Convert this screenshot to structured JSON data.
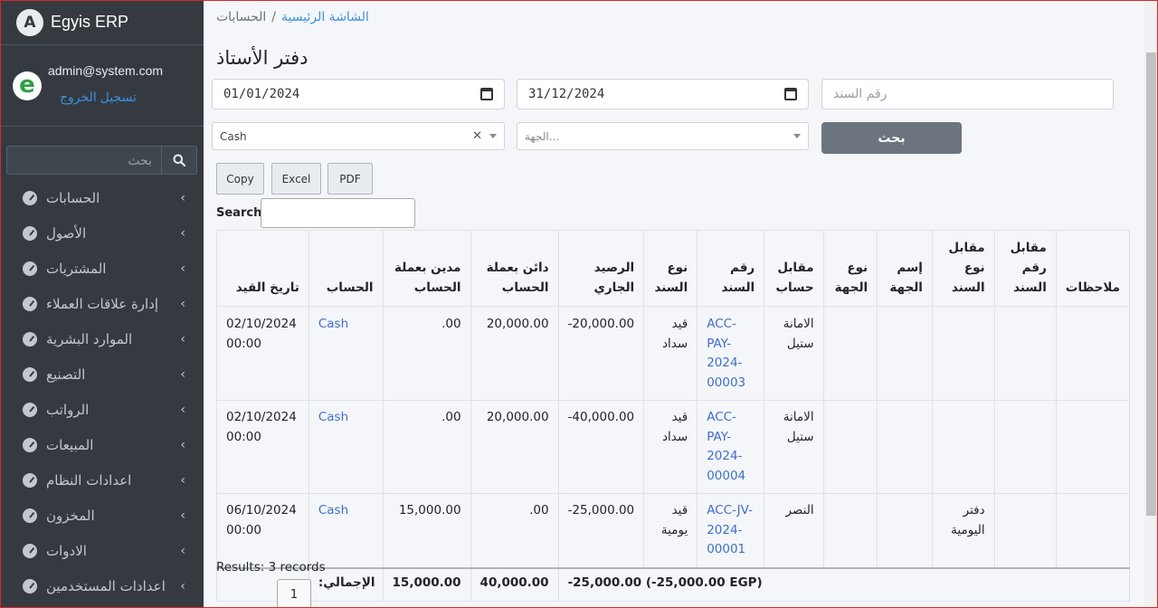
{
  "brand": {
    "logo_letter": "A",
    "name": "Egyis ERP"
  },
  "user": {
    "avatar_letter": "e",
    "email": "admin@system.com",
    "logout": "تسجيل الخروج"
  },
  "sidebar": {
    "search_placeholder": "بحث",
    "items": [
      {
        "label": "الحسابات",
        "icon": "gauge-icon"
      },
      {
        "label": "الأصول",
        "icon": "gauge-icon"
      },
      {
        "label": "المشتريات",
        "icon": "gauge-icon"
      },
      {
        "label": "إدارة علاقات العملاء",
        "icon": "gauge-icon"
      },
      {
        "label": "الموارد البشرية",
        "icon": "gauge-icon"
      },
      {
        "label": "التصنيع",
        "icon": "gauge-icon"
      },
      {
        "label": "الرواتب",
        "icon": "gauge-icon"
      },
      {
        "label": "المبيعات",
        "icon": "gauge-icon"
      },
      {
        "label": "اعدادات النظام",
        "icon": "gauge-icon"
      },
      {
        "label": "المخزون",
        "icon": "gauge-icon"
      },
      {
        "label": "الادوات",
        "icon": "gauge-icon"
      },
      {
        "label": "اعدادات المستخدمين",
        "icon": "gauge-icon"
      }
    ]
  },
  "breadcrumb": {
    "home": "الشاشة الرئيسية",
    "separator": "/",
    "current": "الحسابات"
  },
  "page_title": "دفتر الأستاذ",
  "filters": {
    "date_from": "01/01/2024",
    "date_to": "31/12/2024",
    "voucher_placeholder": "رقم السند",
    "account_value": "Cash",
    "entity_placeholder": "الجهة...",
    "search_button": "بحث"
  },
  "export_buttons": {
    "copy": "Copy",
    "excel": "Excel",
    "pdf": "PDF"
  },
  "table_search_label": "Search:",
  "table": {
    "headers": {
      "date": "تاريخ القيد",
      "account": "الحساب",
      "debit": "مدين بعملة الحساب",
      "credit": "دائن بعملة الحساب",
      "balance": "الرصيد الجاري",
      "voucher_type": "نوع السند",
      "voucher_no": "رقم السند",
      "counter_account": "مقابل حساب",
      "entity_type": "نوع الجهة",
      "entity_name": "إسم الجهة",
      "counter_voucher_type": "مقابل نوع السند",
      "counter_voucher_no": "مقابل رقم السند",
      "notes": "ملاحظات"
    },
    "rows": [
      {
        "date": "02/10/2024",
        "time": "00:00",
        "account": "Cash",
        "debit": ".00",
        "credit": "20,000.00",
        "balance": "-20,000.00",
        "voucher_type_1": "قيد",
        "voucher_type_2": "سداد",
        "voucher_no_1": "ACC-PAY-",
        "voucher_no_2": "2024-",
        "voucher_no_3": "00003",
        "counter_1": "الامانة",
        "counter_2": "ستيل",
        "counter_voucher_type_1": "",
        "counter_voucher_type_2": ""
      },
      {
        "date": "02/10/2024",
        "time": "00:00",
        "account": "Cash",
        "debit": ".00",
        "credit": "20,000.00",
        "balance": "-40,000.00",
        "voucher_type_1": "قيد",
        "voucher_type_2": "سداد",
        "voucher_no_1": "ACC-PAY-",
        "voucher_no_2": "2024-",
        "voucher_no_3": "00004",
        "counter_1": "الامانة",
        "counter_2": "ستيل",
        "counter_voucher_type_1": "",
        "counter_voucher_type_2": ""
      },
      {
        "date": "06/10/2024",
        "time": "00:00",
        "account": "Cash",
        "debit": "15,000.00",
        "credit": ".00",
        "balance": "-25,000.00",
        "voucher_type_1": "قيد",
        "voucher_type_2": "يومية",
        "voucher_no_1": "ACC-JV-",
        "voucher_no_2": "2024-",
        "voucher_no_3": "00001",
        "counter_1": "النصر",
        "counter_2": "",
        "counter_voucher_type_1": "دفتر",
        "counter_voucher_type_2": "اليومية"
      }
    ],
    "footer": {
      "label": ":الإجمالي",
      "debit": "15,000.00",
      "credit": "40,000.00",
      "balance": "-25,000.00 (-25,000.00 EGP)"
    }
  },
  "results_text": "Results: 3 records",
  "pagination": {
    "page": "1"
  }
}
